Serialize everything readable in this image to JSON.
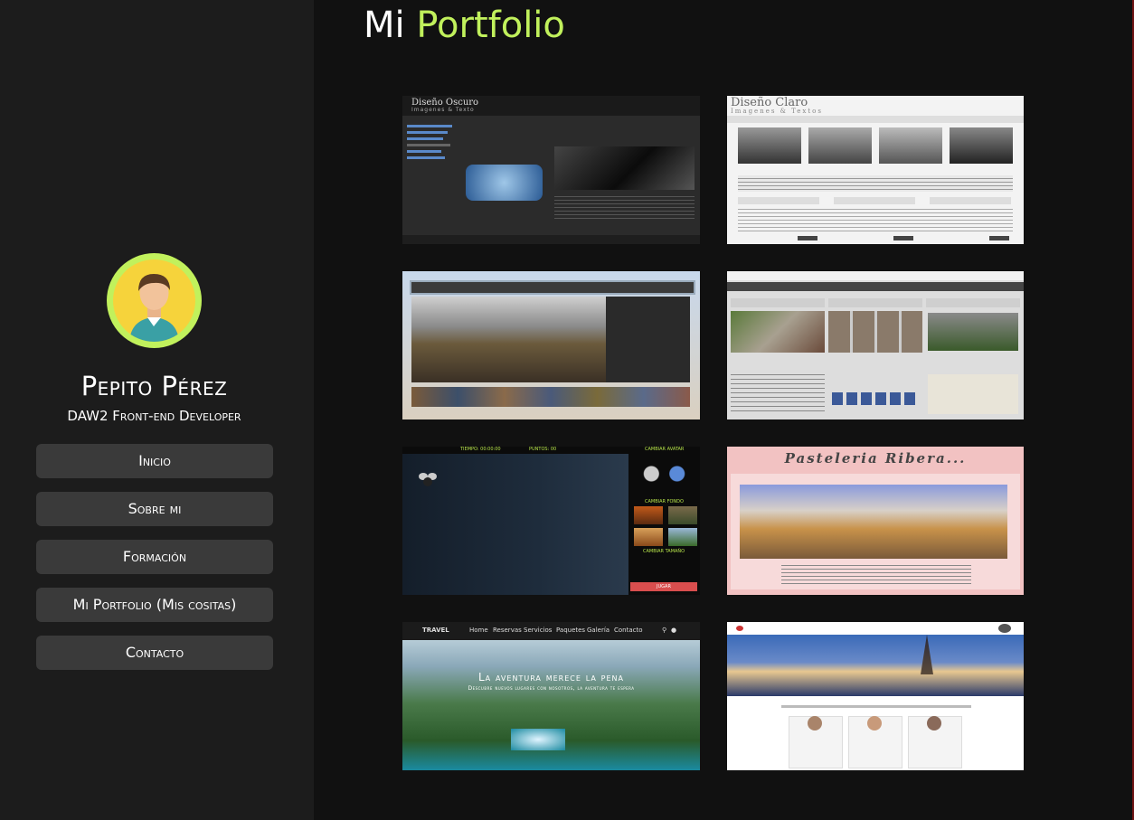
{
  "profile": {
    "name": "Pepito Pérez",
    "role": "DAW2 Front-end Developer"
  },
  "nav": {
    "items": [
      "Inicio",
      "Sobre mi",
      "Formación",
      "Mi Portfolio (Mis cositas)",
      "Contacto"
    ]
  },
  "page": {
    "title_part1": "Mi ",
    "title_part2": "Portfolio"
  },
  "colors": {
    "accent": "#c1f15c",
    "sidebar_bg": "#1c1c1c",
    "main_bg": "#111111",
    "button_bg": "#3a3a3a"
  },
  "portfolio": {
    "diseno_oscuro": {
      "title": "Diseño Oscuro",
      "subtitle": "Imagenes & Texto"
    },
    "diseno_claro": {
      "title": "Diseño Claro",
      "subtitle": "Imagenes & Textos"
    },
    "game": {
      "time": "TIEMPO: 00:00:00",
      "points": "PUNTOS: 00",
      "change_avatar": "CAMBIAR AVATAR",
      "change_bg": "CAMBIAR FONDO",
      "change_size": "CAMBIAR TAMAÑO",
      "play": "JUGAR"
    },
    "pasteleria": {
      "title": "Pasteleria Ribera..."
    },
    "travel": {
      "brand": "TRAVEL",
      "menu": [
        "Home",
        "Reservas",
        "Servicios",
        "Paquetes",
        "Galería",
        "Contacto"
      ],
      "headline": "La aventura merece la pena",
      "subline": "Descubre nuevos lugares con nosotros, la aventura te espera"
    }
  }
}
